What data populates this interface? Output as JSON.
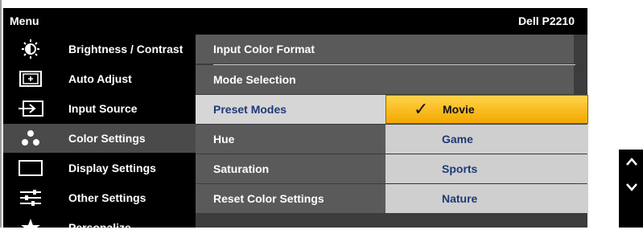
{
  "header": {
    "menu_title": "Menu",
    "model": "Dell P2210"
  },
  "sidebar": {
    "items": [
      {
        "label": "Brightness / Contrast",
        "icon": "brightness-icon"
      },
      {
        "label": "Auto Adjust",
        "icon": "auto-adjust-icon"
      },
      {
        "label": "Input Source",
        "icon": "input-source-icon"
      },
      {
        "label": "Color Settings",
        "icon": "color-settings-icon",
        "active": true
      },
      {
        "label": "Display Settings",
        "icon": "display-settings-icon"
      },
      {
        "label": "Other Settings",
        "icon": "other-settings-icon"
      },
      {
        "label": "Personalize",
        "icon": "personalize-icon"
      }
    ]
  },
  "submenu": {
    "items": [
      {
        "label": "Input Color Format"
      },
      {
        "label": "Mode Selection"
      },
      {
        "label": "Preset Modes",
        "selected": true
      },
      {
        "label": "Hue"
      },
      {
        "label": "Saturation"
      },
      {
        "label": "Reset Color Settings"
      }
    ]
  },
  "preset_options": {
    "items": [
      {
        "label": "Movie",
        "active": true
      },
      {
        "label": "Game"
      },
      {
        "label": "Sports"
      },
      {
        "label": "Nature"
      }
    ]
  },
  "nav": {
    "up_icon": "chevron-up-icon",
    "down_icon": "chevron-down-icon"
  },
  "colors": {
    "highlight": "#f2a800",
    "selected_text": "#1e3a78",
    "active_bg": "#4a4a4a"
  }
}
